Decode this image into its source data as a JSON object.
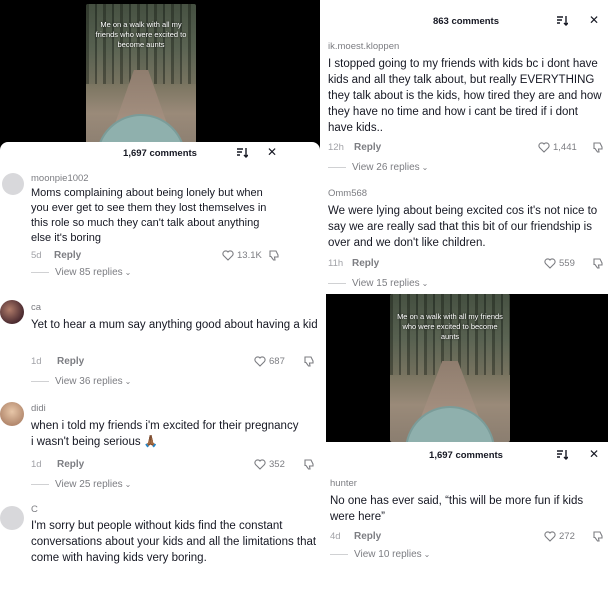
{
  "video": {
    "caption": "Me on a walk with all my friends who were excited to become aunts"
  },
  "sheet_left": {
    "comment_count": "1,697 comments"
  },
  "sheet_right_top": {
    "comment_count": "863 comments"
  },
  "sheet_right_bottom": {
    "comment_count": "1,697 comments"
  },
  "left_comments": [
    {
      "username": "moonpie1002",
      "text": "Moms complaining about being lonely but when you ever get to see them they lost themselves in this role so much they can't talk about anything else it's boring",
      "time": "5d",
      "reply": "Reply",
      "likes": "13.1K",
      "view_replies": "View 85 replies"
    },
    {
      "username": "ca",
      "text": "Yet to hear a mum say anything good about having a kid",
      "time": "1d",
      "reply": "Reply",
      "likes": "687",
      "view_replies": "View 36 replies"
    },
    {
      "username": "didi",
      "text": "when i told my friends i'm excited for their pregnancy i wasn't being serious 🙏🏾",
      "time": "1d",
      "reply": "Reply",
      "likes": "352",
      "view_replies": "View 25 replies"
    },
    {
      "username": "C",
      "text": "I'm sorry but people without kids find the constant conversations about your kids and all the limitations that come with having kids very boring."
    }
  ],
  "right_comments": [
    {
      "username": "ik.moest.kloppen",
      "text": "I stopped going to my friends with kids bc i dont have kids and all they talk about, but really EVERYTHING they talk about is the kids, how tired they are and how they have no time and how i cant be tired if i dont have kids..",
      "time": "12h",
      "reply": "Reply",
      "likes": "1,441",
      "view_replies": "View 26 replies"
    },
    {
      "username": "Omm568",
      "text": "We were lying about being excited cos it's not nice to say we are really sad that this bit of our friendship is over and we don't like children.",
      "time": "11h",
      "reply": "Reply",
      "likes": "559",
      "view_replies": "View 15 replies"
    },
    {
      "username": "hunter",
      "text": "No one has ever said, “this will be more fun if kids were here”",
      "time": "4d",
      "reply": "Reply",
      "likes": "272",
      "view_replies": "View 10 replies"
    }
  ],
  "icons": {
    "sort": "sort-icon",
    "close": "close-icon",
    "heart": "heart-icon",
    "dislike": "dislike-icon",
    "chevron": "chevron-down-icon"
  }
}
